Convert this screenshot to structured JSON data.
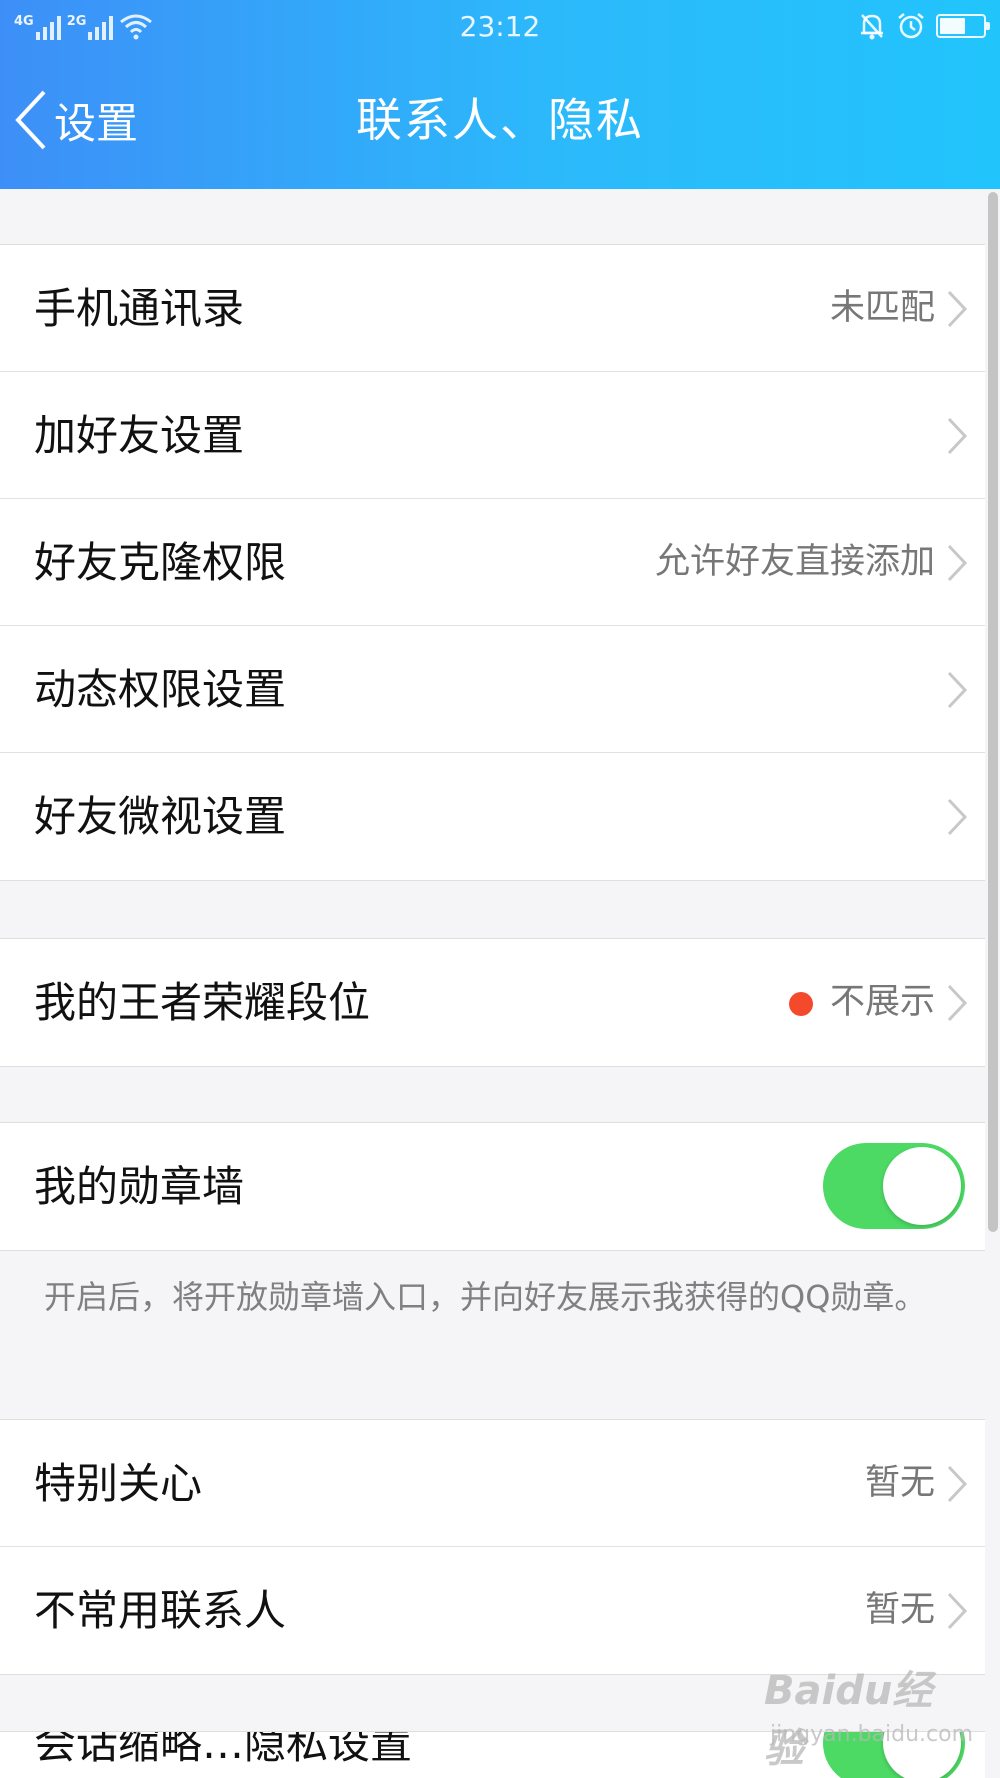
{
  "status_bar": {
    "network_1": "4G",
    "network_2": "2G",
    "time": "23:12",
    "icons": [
      "signal-icon",
      "wifi-icon",
      "bell-muted-icon",
      "alarm-icon",
      "battery-icon"
    ],
    "battery_level": 0.6
  },
  "nav": {
    "back_label": "设置",
    "title": "联系人、隐私"
  },
  "groups": {
    "contacts": [
      {
        "label": "手机通讯录",
        "value": "未匹配"
      },
      {
        "label": "加好友设置",
        "value": ""
      },
      {
        "label": "好友克隆权限",
        "value": "允许好友直接添加"
      },
      {
        "label": "动态权限设置",
        "value": ""
      },
      {
        "label": "好友微视设置",
        "value": ""
      }
    ],
    "game": {
      "label": "我的王者荣耀段位",
      "value": "不展示",
      "dot_color": "#f4492b"
    },
    "medal": {
      "label": "我的勋章墙",
      "toggle_on": true,
      "description": "开启后，将开放勋章墙入口，并向好友展示我获得的QQ勋章。"
    },
    "special": [
      {
        "label": "特别关心",
        "value": "暂无"
      },
      {
        "label": "不常用联系人",
        "value": "暂无"
      }
    ],
    "partial": {
      "label": "会话缩略…隐私设置",
      "toggle_on": true
    }
  },
  "watermark": {
    "main": "Baidu经验",
    "sub": "jingyan.baidu.com"
  },
  "colors": {
    "header_start": "#3d8ff7",
    "header_end": "#22c4fc",
    "toggle_on": "#4cd964",
    "dot": "#f4492b"
  }
}
